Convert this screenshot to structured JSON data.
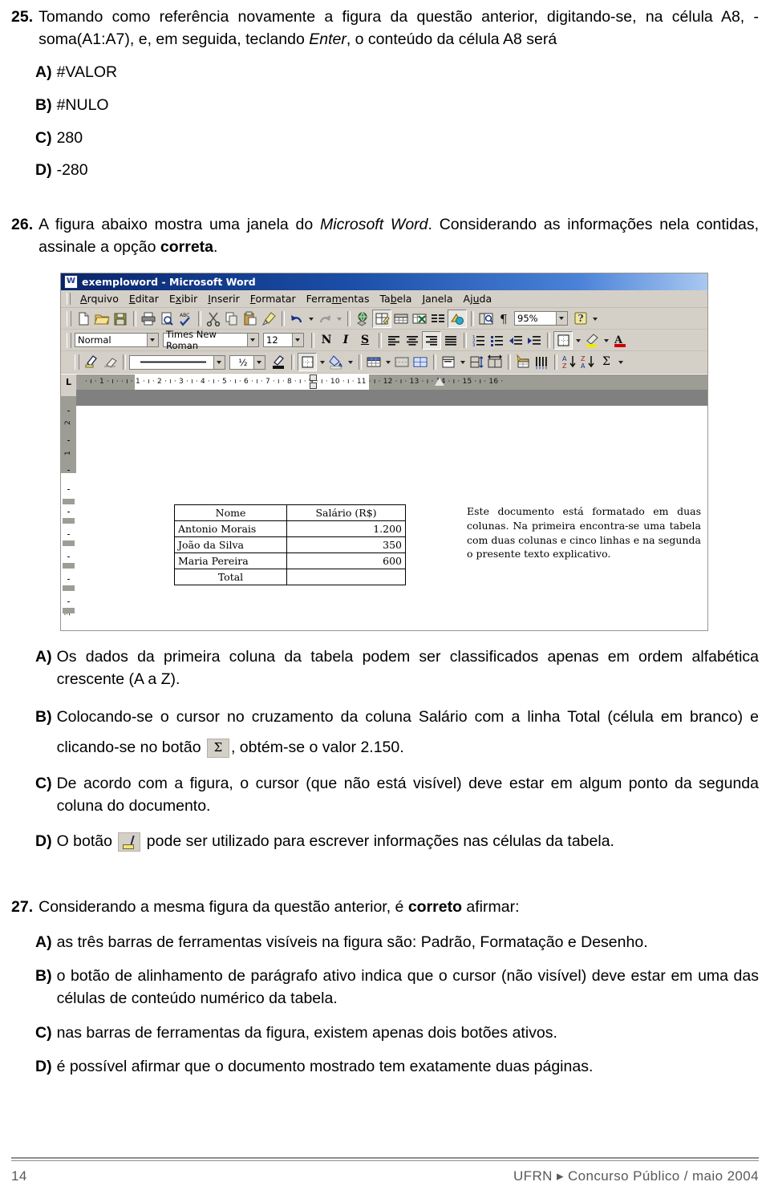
{
  "questions": [
    {
      "number": "25.",
      "stem_parts": [
        {
          "t": "Tomando como referência novamente a figura da questão anterior, digitando-se, na célula A8, -soma(A1:A7), e, em seguida, teclando ",
          "s": "normal"
        },
        {
          "t": "Enter",
          "s": "italic"
        },
        {
          "t": ", o conteúdo da célula A8 será",
          "s": "normal"
        }
      ],
      "stem_plain": "Tomando como referência novamente a figura da questão anterior, digitando-se, na célula A8, -soma(A1:A7), e, em seguida, teclando Enter, o conteúdo da célula A8 será",
      "options": [
        {
          "letter": "A)",
          "text": "#VALOR"
        },
        {
          "letter": "B)",
          "text": "#NULO"
        },
        {
          "letter": "C)",
          "text": "280"
        },
        {
          "letter": "D)",
          "text": "-280"
        }
      ]
    },
    {
      "number": "26.",
      "stem_plain": "A figura abaixo mostra uma janela do Microsoft Word. Considerando as informações nela contidas, assinale a opção correta.",
      "stem_pre": "A figura abaixo mostra uma janela do ",
      "stem_italic": "Microsoft Word",
      "stem_mid": ". Considerando as informações nela contidas, assinale a opção ",
      "stem_bold": "correta",
      "stem_post": ".",
      "options": [
        {
          "letter": "A)",
          "text": "Os dados da primeira coluna da tabela podem ser classificados apenas em ordem alfabética crescente (A a Z)."
        },
        {
          "letter": "B)",
          "pre": "Colocando-se o cursor no cruzamento da coluna Salário com a linha Total (célula em branco) e clicando-se no botão ",
          "icon": "sigma-autosum-icon",
          "icon_glyph": "Σ",
          "post": ",  obtém-se  o valor 2.150."
        },
        {
          "letter": "C)",
          "text": "De acordo com a figura, o cursor (que não está visível) deve estar em algum ponto da segunda coluna do documento."
        },
        {
          "letter": "D)",
          "pre": "O botão ",
          "icon": "draw-table-pen-icon",
          "post": " pode ser utilizado para escrever informações nas células da tabela."
        }
      ]
    },
    {
      "number": "27.",
      "stem_pre": "Considerando a mesma figura da questão anterior, é ",
      "stem_bold": "correto",
      "stem_post": " afirmar:",
      "stem_plain": "Considerando a mesma figura da questão anterior, é correto afirmar:",
      "options": [
        {
          "letter": "A)",
          "text": "as três barras de ferramentas visíveis na figura são: Padrão, Formatação e Desenho."
        },
        {
          "letter": "B)",
          "text": "o botão de alinhamento de parágrafo ativo indica que o cursor (não visível) deve estar em uma das células de conteúdo numérico da tabela."
        },
        {
          "letter": "C)",
          "text": "nas barras de ferramentas da figura, existem apenas dois botões ativos."
        },
        {
          "letter": "D)",
          "text": "é possível afirmar que o documento mostrado tem exatamente duas páginas."
        }
      ]
    }
  ],
  "word_window": {
    "titlebar": {
      "icon": "word-document-icon",
      "title": "exemploword - Microsoft Word"
    },
    "menu": [
      {
        "label": "Arquivo",
        "accel": "A"
      },
      {
        "label": "Editar",
        "accel": "E"
      },
      {
        "label": "Exibir",
        "accel": "x"
      },
      {
        "label": "Inserir",
        "accel": "I"
      },
      {
        "label": "Formatar",
        "accel": "F"
      },
      {
        "label": "Ferramentas",
        "accel": "m"
      },
      {
        "label": "Tabela",
        "accel": "b"
      },
      {
        "label": "Janela",
        "accel": "J"
      },
      {
        "label": "Ajuda",
        "accel": "u"
      }
    ],
    "standard_toolbar": {
      "buttons": [
        "new-document-icon",
        "open-folder-icon",
        "save-disk-icon",
        "print-icon",
        "print-preview-icon",
        "spelling-check-icon",
        "cut-scissors-icon",
        "copy-icon",
        "paste-clipboard-icon",
        "format-painter-icon",
        "undo-icon",
        "redo-icon",
        "insert-hyperlink-icon",
        "tables-and-borders-icon",
        "insert-table-icon",
        "insert-excel-worksheet-icon",
        "columns-icon",
        "drawing-icon",
        "document-map-icon",
        "show-formatting-marks-icon"
      ],
      "zoom_value": "95%",
      "help_button": "help-question-icon"
    },
    "formatting_toolbar": {
      "style_value": "Normal",
      "font_value": "Times New Roman",
      "size_value": "12",
      "bold_label": "N",
      "italic_label": "I",
      "underline_label": "S",
      "align_buttons": [
        "align-left-icon",
        "align-center-icon",
        "align-right-icon",
        "align-justify-icon"
      ],
      "active_align": "align-right-icon",
      "list_buttons": [
        "numbered-list-icon",
        "bulleted-list-icon",
        "decrease-indent-icon",
        "increase-indent-icon"
      ],
      "right_buttons": [
        "borders-icon",
        "highlight-color-icon",
        "font-color-icon"
      ]
    },
    "tables_borders_toolbar": {
      "line_weight_value": "½",
      "buttons": [
        "draw-table-pen-icon",
        "eraser-icon",
        "line-style-combo",
        "line-weight-combo",
        "border-color-icon",
        "borders-icon",
        "shading-color-icon",
        "insert-table-icon",
        "merge-cells-icon",
        "split-cells-icon",
        "align-top-icon",
        "distribute-rows-evenly-icon",
        "distribute-columns-evenly-icon",
        "table-autoformat-icon",
        "change-text-direction-icon",
        "sort-ascending-icon",
        "sort-descending-icon",
        "autosum-icon"
      ],
      "autosum_glyph": "Σ"
    },
    "ruler": {
      "tab_selector": "L",
      "h_marks": "·  ı  ·  1  ·  ı  ·      ·  ı  ·  1  ·  ı  ·  2  ·  ı  ·  3  ·  ı  ·  4  ·  ı  ·  5  ·  ı  ·  6  ·  ı  ·  7  ·  ı  ·  8  ·  ı  ·  9  ·  ı  · 10 ·  ı  · 11 ·  ı  · 12 ·  ı  · 13 ·  ı  · 14 ·  ı  · 15 ·  ı  · 16 ·",
      "v_labels": [
        "2",
        "1",
        "1",
        "2",
        "3"
      ]
    },
    "document": {
      "table": {
        "headers": [
          "Nome",
          "Salário (R$)"
        ],
        "rows": [
          [
            "Antonio Morais",
            "1.200"
          ],
          [
            "João da Silva",
            "350"
          ],
          [
            "Maria Pereira",
            "600"
          ],
          [
            "Total",
            ""
          ]
        ]
      },
      "second_column_text": "Este documento está formatado em duas colunas. Na primeira encontra-se uma tabela com duas colunas e cinco linhas e na segunda o presente texto explicativo."
    }
  },
  "footer": {
    "page_number": "14",
    "credit": "UFRN ▸ Concurso Público / maio 2004"
  }
}
